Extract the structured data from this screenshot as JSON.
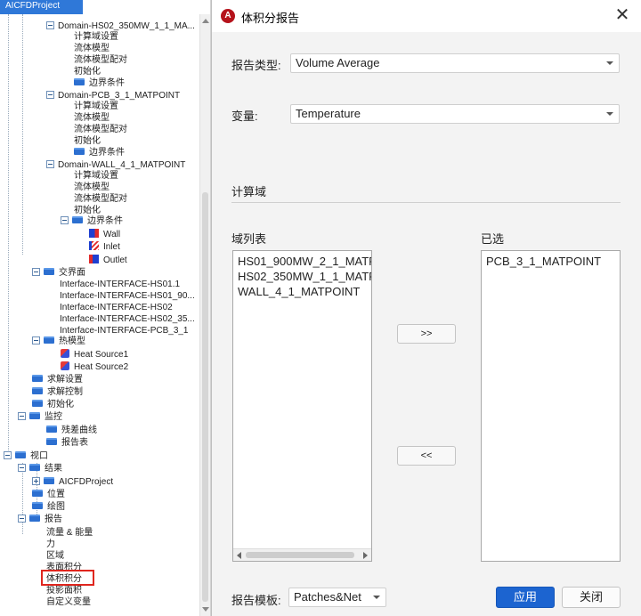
{
  "tree": {
    "header": "AICFDProject",
    "rows": [
      "Domain-HS02_350MW_1_1_MA...",
      "计算域设置",
      "流体模型",
      "流体模型配对",
      "初始化",
      "边界条件",
      "Domain-PCB_3_1_MATPOINT",
      "计算域设置",
      "流体模型",
      "流体模型配对",
      "初始化",
      "边界条件",
      "Domain-WALL_4_1_MATPOINT",
      "计算域设置",
      "流体模型",
      "流体模型配对",
      "初始化",
      "边界条件",
      "Wall",
      "Inlet",
      "Outlet",
      "交界面",
      "Interface-INTERFACE-HS01.1",
      "Interface-INTERFACE-HS01_90...",
      "Interface-INTERFACE-HS02",
      "Interface-INTERFACE-HS02_35...",
      "Interface-INTERFACE-PCB_3_1",
      "热模型",
      "Heat Source1",
      "Heat Source2",
      "求解设置",
      "求解控制",
      "初始化",
      "监控",
      "残差曲线",
      "报告表",
      "视口",
      "结果",
      "AICFDProject",
      "位置",
      "绘图",
      "报告",
      "流量 & 能量",
      "力",
      "区域",
      "表面积分",
      "体积积分",
      "投影面积",
      "自定义变量"
    ]
  },
  "dialog": {
    "logo_glyph": "A",
    "title": "体积分报告",
    "close_glyph": "✕",
    "report_type_label": "报告类型:",
    "report_type_value": "Volume Average",
    "variable_label": "变量:",
    "variable_value": "Temperature",
    "domain_section_label": "计算域",
    "domain_list_label": "域列表",
    "selected_label": "已选",
    "domain_list": [
      "HS01_900MW_2_1_MATP",
      "HS02_350MW_1_1_MATP",
      "WALL_4_1_MATPOINT"
    ],
    "selected_list": [
      "PCB_3_1_MATPOINT"
    ],
    "add_button": ">>",
    "remove_button": "<<",
    "template_label": "报告模板:",
    "template_value": "Patches&Net",
    "apply_button": "应用",
    "close_button": "关闭"
  },
  "colors": {
    "accent": "#1c64d0",
    "highlight": "#e0261e"
  }
}
